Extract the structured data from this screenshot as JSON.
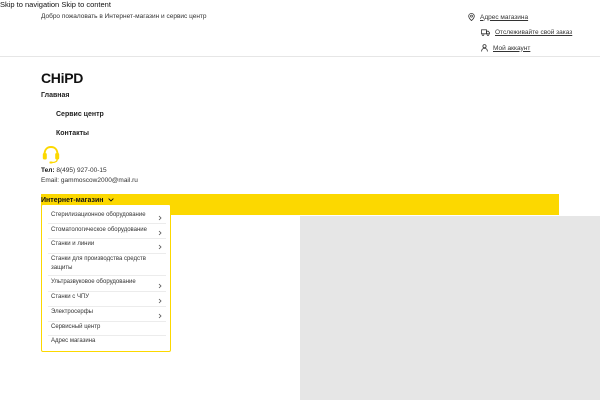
{
  "skip": {
    "navigation": "Skip to navigation",
    "content": "Skip to content"
  },
  "topbar": {
    "welcome": "Добро пожаловать в Интернет-магазин и сервис центр",
    "address": "Адрес магазина",
    "track": "Отслеживайте свой заказ",
    "account": "Мой аккаунт"
  },
  "logo": "CHiPD",
  "nav": {
    "home": "Главная",
    "service": "Сервис центр",
    "contacts": "Контакты"
  },
  "contact": {
    "phone_label": "Тел:",
    "phone": "8(495) 927-00-15",
    "email": "Email: gammoscow2000@mail.ru"
  },
  "shop_menu": {
    "label": "Интернет-магазин",
    "items": [
      {
        "label": "Стерилизационное оборудование",
        "submenu": true
      },
      {
        "label": "Стоматологическое оборудование",
        "submenu": true
      },
      {
        "label": "Станки и линии",
        "submenu": true
      },
      {
        "label": "Станки для производства средств защиты",
        "submenu": false
      },
      {
        "label": "Ультразвуковое оборудование",
        "submenu": true
      },
      {
        "label": "Станки с ЧПУ",
        "submenu": true
      },
      {
        "label": "Электросерфы",
        "submenu": true
      },
      {
        "label": "Сервисный центр",
        "submenu": false
      },
      {
        "label": "Адрес магазина",
        "submenu": false
      }
    ]
  },
  "colors": {
    "accent": "#fcd800",
    "placeholder": "#e6e6e6",
    "text": "#222222"
  },
  "icons": {
    "address": "map-pin-icon",
    "track": "truck-icon",
    "account": "user-icon",
    "support": "headset-icon",
    "chevron": "chevron-right-icon"
  }
}
